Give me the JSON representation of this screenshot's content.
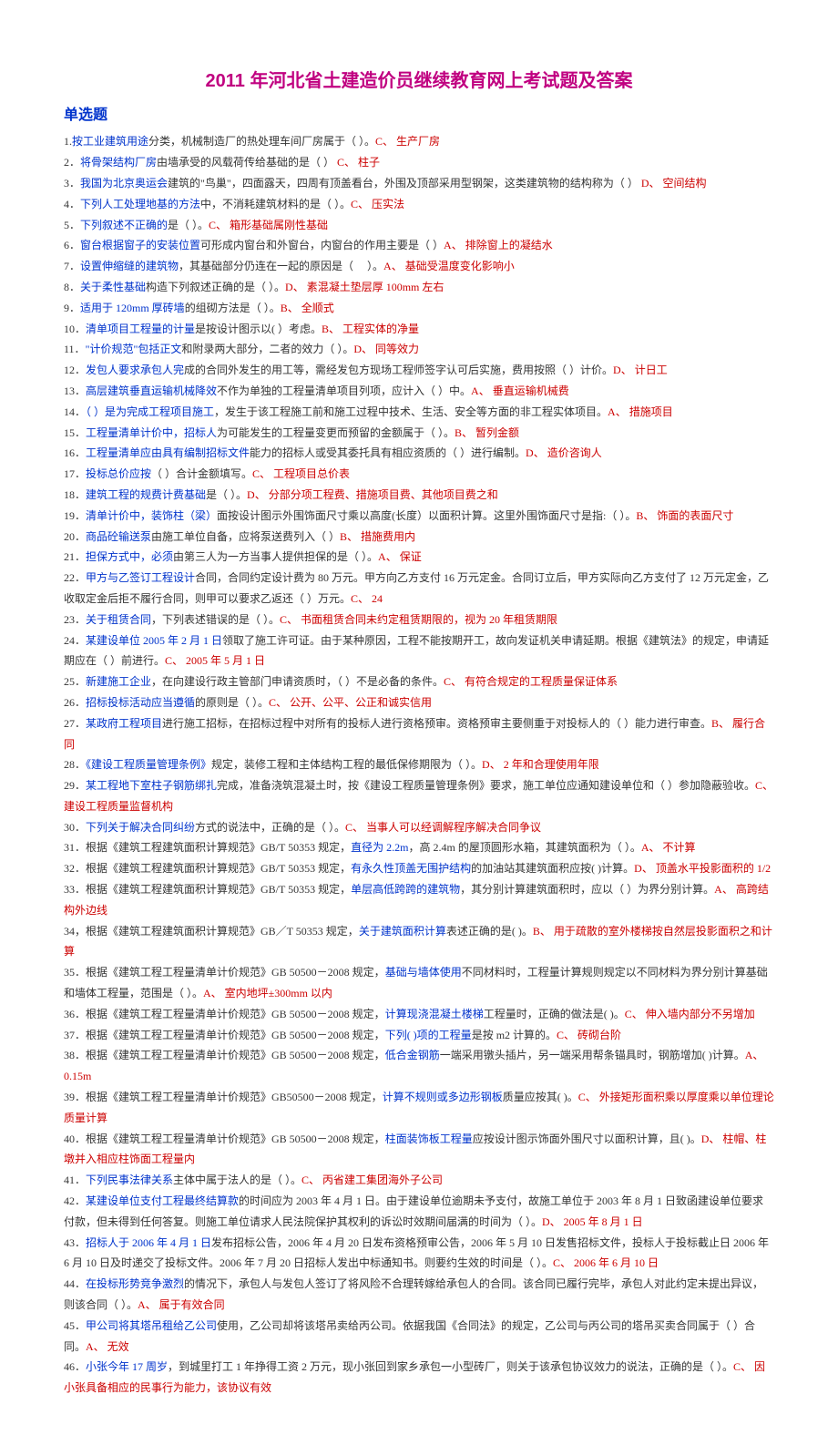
{
  "title": "2011 年河北省土建造价员继续教育网上考试题及答案",
  "section": "单选题",
  "questions": [
    {
      "n": "1",
      "pre": ".",
      "b": "按工业建筑用途",
      "m": "分类，机械制造厂的热处理车间厂房属于（ ）。",
      "a": "C、 生产厂房"
    },
    {
      "n": "2",
      "pre": "．",
      "b": "将骨架结构厂房",
      "m": "由墙承受的风载荷传给基础的是（ ）",
      "a": "  C、 柱子"
    },
    {
      "n": "3",
      "pre": "．",
      "b": "我国为北京奥运会",
      "m": "建筑的\"鸟巢\"，四面露天，四周有顶盖看台，外围及顶部采用型钢架，这类建筑物的结构称为（ ）",
      "a": "  D、 空间结构"
    },
    {
      "n": "4",
      "pre": "．",
      "b": "下列人工处理地基的方法",
      "m": "中，不消耗建筑材料的是（ ）。",
      "a": "C、 压实法"
    },
    {
      "n": "5",
      "pre": "．",
      "b": "下列叙述不正确的",
      "m": "是（ ）。",
      "a": "C、 箱形基础属刚性基础"
    },
    {
      "n": "6",
      "pre": "．",
      "b": "窗台根据窗子的安装位置",
      "m": "可形成内窗台和外窗台，内窗台的作用主要是（ ）",
      "a": "A、 排除窗上的凝结水"
    },
    {
      "n": "7",
      "pre": "．",
      "b": "设置伸缩缝的建筑物",
      "m": "，其基础部分仍连在一起的原因是（ 　）。",
      "a": "A、 基础受温度变化影响小"
    },
    {
      "n": "8",
      "pre": "．",
      "b": "关于柔性基础",
      "m": "构造下列叙述正确的是（ ）。",
      "a": "D、 素混凝土垫层厚 100mm 左右"
    },
    {
      "n": "9",
      "pre": "．",
      "b": "适用于 120mm 厚砖墙",
      "m": "的组砌方法是（ ）。",
      "a": "B、 全顺式"
    },
    {
      "n": "10",
      "pre": "．",
      "b": "清单项目工程量的计量",
      "m": "是按设计图示以( ）考虑。",
      "a": "B、 工程实体的净量"
    },
    {
      "n": "11",
      "pre": "．",
      "b": "\"计价规范\"包括正文",
      "m": "和附录两大部分，二者的效力（ ）。",
      "a": "D、 同等效力"
    },
    {
      "n": "12",
      "pre": "．",
      "b": "发包人要求承包人完",
      "m": "成的合同外发生的用工等，需经发包方现场工程师签字认可后实施，费用按照（ ）计价。",
      "a": "D、 计日工"
    },
    {
      "n": "13",
      "pre": "．",
      "b": "高层建筑垂直运输机械降效",
      "m": "不作为单独的工程量清单项目列项，应计入（ ）中。",
      "a": "A、 垂直运输机械费"
    },
    {
      "n": "14",
      "pre": "．",
      "b": "（ ）是为完成工程项目施工",
      "m": "，发生于该工程施工前和施工过程中技术、生活、安全等方面的非工程实体项目。",
      "a": "A、 措施项目"
    },
    {
      "n": "15",
      "pre": "．",
      "b": "工程量清单计价中，招标人",
      "m": "为可能发生的工程量变更而预留的金额属于（ ）。",
      "a": "B、 暂列金额"
    },
    {
      "n": "16",
      "pre": "．",
      "b": "工程量清单应由具有编制招标文件",
      "m": "能力的招标人或受其委托具有相应资质的（ ）进行编制。",
      "a": "D、 造价咨询人"
    },
    {
      "n": "17",
      "pre": "．",
      "b": "投标总价应按",
      "m": "（ ）合计金额填写。",
      "a": "C、 工程项目总价表"
    },
    {
      "n": "18",
      "pre": "．",
      "b": "建筑工程的规费计费基础",
      "m": "是（ ）。",
      "a": "D、 分部分项工程费、措施项目费、其他项目费之和"
    },
    {
      "n": "19",
      "pre": "．",
      "b": "清单计价中，装饰柱（梁）",
      "m": "面按设计图示外围饰面尺寸乘以高度(长度）以面积计算。这里外围饰面尺寸是指:（ ）。",
      "a": "B、 饰面的表面尺寸"
    },
    {
      "n": "20",
      "pre": "．",
      "b": "商品砼输送泵",
      "m": "由施工单位自备，应将泵送费列入（ ）",
      "a": "B、 措施费用内"
    },
    {
      "n": "21",
      "pre": "．",
      "b": "担保方式中，必须",
      "m": "由第三人为一方当事人提供担保的是（ ）。",
      "a": "A、 保证"
    },
    {
      "n": "22",
      "pre": "．",
      "b": "甲方与乙签订工程设计",
      "m": "合同，合同约定设计费为 80 万元。甲方向乙方支付 16 万元定金。合同订立后，甲方实际向乙方支付了 12 万元定金，乙收取定金后拒不履行合同，则甲可以要求乙返还（ ）万元。",
      "a": "C、 24"
    },
    {
      "n": "23",
      "pre": "．",
      "b": "关于租赁合同",
      "m": "，下列表述错误的是（ ）。",
      "a": "C、 书面租赁合同未约定租赁期限的，视为 20 年租赁期限"
    },
    {
      "n": "24",
      "pre": "．",
      "b": "某建设单位 2005 年 2 月 1 日",
      "m": "领取了施工许可证。由于某种原因，工程不能按期开工，故向发证机关申请延期。根据《建筑法》的规定，申请延期应在（ ）前进行。",
      "a": "C、 2005 年 5 月 1 日"
    },
    {
      "n": "25",
      "pre": "．",
      "b": "新建施工企业",
      "m": "，在向建设行政主管部门申请资质时，（ ）不是必备的条件。",
      "a": "C、 有符合规定的工程质量保证体系"
    },
    {
      "n": "26",
      "pre": "．",
      "b": "招标投标活动应当遵循",
      "m": "的原则是（ ）。",
      "a": "C、 公开、公平、公正和诚实信用"
    },
    {
      "n": "27",
      "pre": "．",
      "b": "某政府工程项目",
      "m": "进行施工招标，在招标过程中对所有的投标人进行资格预审。资格预审主要侧重于对投标人的（ ）能力进行审查。",
      "a": "B、 履行合同"
    },
    {
      "n": "28",
      "pre": "．",
      "b": "《建设工程质量管理条例》",
      "m": "规定，装修工程和主体结构工程的最低保修期限为（ ）。",
      "a": "D、 2 年和合理使用年限"
    },
    {
      "n": "29",
      "pre": "．",
      "b": "某工程地下室柱子钢筋绑扎",
      "m": "完成，准备浇筑混凝土时，按《建设工程质量管理条例》要求，施工单位应通知建设单位和（ ）参加隐蔽验收。",
      "a": "C、 建设工程质量监督机构"
    },
    {
      "n": "30",
      "pre": "．",
      "b": "下列关于解决合同纠纷",
      "m": "方式的说法中，正确的是（ ）。",
      "a": "C、 当事人可以经调解程序解决合同争议"
    },
    {
      "n": "31",
      "pre": "．",
      "m": "根据《建筑工程建筑面积计算规范》GB/T 50353 规定，",
      "b2": "直径为 2.2m",
      "m2": "，高 2.4m 的屋顶圆形水箱，其建筑面积为（ ）。",
      "a": "A、 不计算"
    },
    {
      "n": "32",
      "pre": "．",
      "m": "根据《建筑工程建筑面积计算规范》GB/T 50353 规定，",
      "b2": "有永久性顶盖无围护结构",
      "m2": "的加油站其建筑面积应按( )计算。",
      "a": "D、 顶盖水平投影面积的 1/2"
    },
    {
      "n": "33",
      "pre": "．",
      "m": "根据《建筑工程建筑面积计算规范》GB/T 50353 规定，",
      "b2": "单层高低跨跨的建筑物",
      "m2": "，其分别计算建筑面积时，应以（ ）为界分别计算。",
      "a": "A、 高跨结构外边线"
    },
    {
      "n": "34",
      "pre": "，",
      "m": "根据《建筑工程建筑面积计算规范》GB／T 50353 规定，",
      "b2": "关于建筑面积计算",
      "m2": "表述正确的是( )。",
      "a": "B、 用于疏散的室外楼梯按自然层投影面积之和计算"
    },
    {
      "n": "35",
      "pre": "．",
      "m": "根据《建筑工程工程量清单计价规范》GB 50500－2008 规定，",
      "b2": "基础与墙体使用",
      "m2": "不同材料时，工程量计算规则规定以不同材料为界分别计算基础和墙体工程量，范围是（ ）。",
      "a": "A、 室内地坪±300mm 以内"
    },
    {
      "n": "36",
      "pre": "．",
      "m": "根据《建筑工程工程量清单计价规范》GB 50500－2008 规定，",
      "b2": "计算现浇混凝土楼梯",
      "m2": "工程量时，正确的做法是( )。",
      "a": "C、 伸入墙内部分不另增加"
    },
    {
      "n": "37",
      "pre": "．",
      "m": "根据《建筑工程工程量清单计价规范》GB 50500－2008 规定，",
      "b2": "下列( )项的工程量",
      "m2": "是按 m2 计算的。",
      "a": "C、 砖砌台阶"
    },
    {
      "n": "38",
      "pre": "．",
      "m": "根据《建筑工程工程量清单计价规范》GB 50500－2008 规定，",
      "b2": "低合金钢筋",
      "m2": "一端采用镦头插片，另一端采用帮条锚具时，钢筋增加( )计算。",
      "a": "A、 0.15m"
    },
    {
      "n": "39",
      "pre": "．",
      "m": "根据《建筑工程工程量清单计价规范》GB50500－2008 规定，",
      "b2": "计算不规则或多边形钢板",
      "m2": "质量应按其( )。",
      "a": "C、 外接矩形面积乘以厚度乘以单位理论质量计算"
    },
    {
      "n": "40",
      "pre": "．",
      "m": "根据《建筑工程工程量清单计价规范》GB 50500－2008 规定，",
      "b2": "柱面装饰板工程量",
      "m2": "应按设计图示饰面外围尺寸以面积计算，且( )。",
      "a": "D、 柱帽、柱墩并入相应柱饰面工程量内"
    },
    {
      "n": "41",
      "pre": "．",
      "b": "下列民事法律关系",
      "m": "主体中属于法人的是（ ）。",
      "a": "C、 丙省建工集团海外子公司"
    },
    {
      "n": "42",
      "pre": "．",
      "b": "某建设单位支付工程最终结算款",
      "m": "的时间应为 2003 年 4 月 1 日。由于建设单位逾期未予支付，故施工单位于 2003 年 8 月 1 日致函建设单位要求付款，但未得到任何答复。则施工单位请求人民法院保护其权利的诉讼时效期间届满的时间为（ ）。",
      "a": "D、 2005 年 8 月 1 日"
    },
    {
      "n": "43",
      "pre": "．",
      "b": "招标人于 2006 年 4 月 1 日",
      "m": "发布招标公告，2006 年 4 月 20 日发布资格预审公告，2006 年 5 月 10 日发售招标文件，投标人于投标截止日 2006 年 6 月 10 日及时递交了投标文件。2006 年 7 月 20 日招标人发出中标通知书。则要约生效的时间是（ ）。",
      "a": "C、 2006 年 6 月 10 日"
    },
    {
      "n": "44",
      "pre": "．",
      "b": "在投标形势竞争激烈",
      "m": "的情况下，承包人与发包人签订了将风险不合理转嫁给承包人的合同。该合同已履行完毕，承包人对此约定未提出异议，则该合同（ ）。",
      "a": "A、 属于有效合同"
    },
    {
      "n": "45",
      "pre": "．",
      "b": "甲公司将其塔吊租给乙公司",
      "m": "使用，乙公司却将该塔吊卖给丙公司。依据我国《合同法》的规定，乙公司与丙公司的塔吊买卖合同属于（ ）合同。",
      "a": "A、 无效"
    },
    {
      "n": "46",
      "pre": "．",
      "b": "小张今年 17 周岁",
      "m": "，到城里打工 1 年挣得工资 2 万元，现小张回到家乡承包一小型砖厂，则关于该承包协议效力的说法，正确的是（ ）。",
      "a": "C、 因小张具备相应的民事行为能力，该协议有效"
    }
  ]
}
